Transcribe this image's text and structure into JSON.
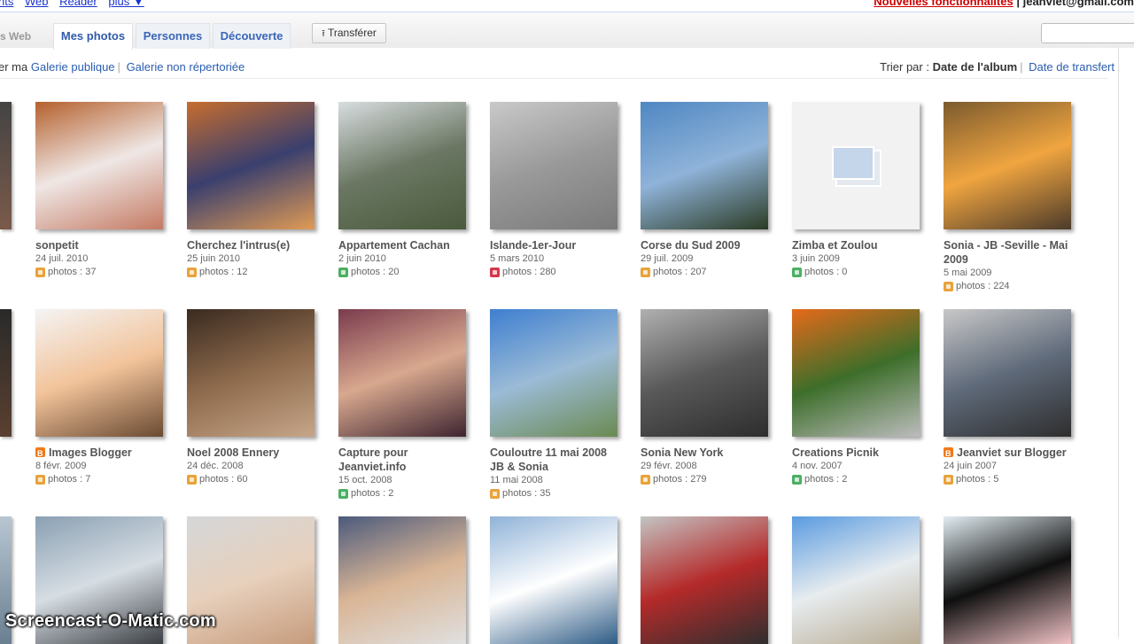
{
  "gbar": {
    "left_links": [
      "nts",
      "Web",
      "Reader",
      "plus ▼"
    ],
    "new_features": "Nouvelles fonctionnalités",
    "separator": "|",
    "account": "jeanviet@gmail.com"
  },
  "tabs": {
    "prefix": "s Web",
    "items": [
      {
        "label": "Mes photos",
        "active": true
      },
      {
        "label": "Personnes",
        "active": false
      },
      {
        "label": "Découverte",
        "active": false
      }
    ],
    "upload_label": "Transférer",
    "search_placeholder": ""
  },
  "subheader": {
    "prefix": "er ma",
    "public_gallery": "Galerie publique",
    "unlisted_gallery": "Galerie non répertoriée",
    "sep": "|",
    "sort_label": "Trier par :",
    "sort_active": "Date de l'album",
    "sort_other": "Date de transfert"
  },
  "albums": [
    {
      "title": "sonpetit",
      "date": "24 juil. 2010",
      "count": "photos : 37",
      "visibility": "unlisted",
      "blogger": false,
      "thumb": [
        "#b5602d",
        "#efe7e5",
        "#c47a63"
      ]
    },
    {
      "title": "Cherchez l'intrus(e)",
      "date": "25 juin 2010",
      "count": "photos : 12",
      "visibility": "unlisted",
      "blogger": false,
      "thumb": [
        "#c66d2e",
        "#3a3f6e",
        "#e09b55"
      ]
    },
    {
      "title": "Appartement Cachan",
      "date": "2 juin 2010",
      "count": "photos : 20",
      "visibility": "public",
      "blogger": false,
      "thumb": [
        "#d8dde0",
        "#6b7763",
        "#4a5a3c"
      ]
    },
    {
      "title": "Islande-1er-Jour",
      "date": "5 mars 2010",
      "count": "photos : 280",
      "visibility": "private",
      "blogger": false,
      "thumb": [
        "#c9c9c9",
        "#999",
        "#7a7a7a"
      ]
    },
    {
      "title": "Corse du Sud 2009",
      "date": "29 juil. 2009",
      "count": "photos : 207",
      "visibility": "unlisted",
      "blogger": false,
      "thumb": [
        "#4f87c2",
        "#8fb3d9",
        "#2b3b24"
      ]
    },
    {
      "title": "Zimba et Zoulou",
      "date": "3 juin 2009",
      "count": "photos : 0",
      "visibility": "public",
      "blogger": false,
      "thumb": [
        "#f1f1f1",
        "#f1f1f1",
        "#f1f1f1"
      ],
      "empty": true
    },
    {
      "title": "Sonia - JB -Seville - Mai 2009",
      "date": "5 mai 2009",
      "count": "photos : 224",
      "visibility": "unlisted",
      "blogger": false,
      "thumb": [
        "#7b5a2e",
        "#f0a540",
        "#4b3a2a"
      ]
    },
    {
      "title": "Images Blogger",
      "date": "8 févr. 2009",
      "count": "photos : 7",
      "visibility": "unlisted",
      "blogger": true,
      "thumb": [
        "#f4f4f4",
        "#f2c39a",
        "#6a4a32"
      ]
    },
    {
      "title": "Noel 2008 Ennery",
      "date": "24 déc. 2008",
      "count": "photos : 60",
      "visibility": "unlisted",
      "blogger": false,
      "thumb": [
        "#3a2a20",
        "#8d6a4c",
        "#c7a588"
      ]
    },
    {
      "title": "Capture pour Jeanviet.info",
      "date": "15 oct. 2008",
      "count": "photos : 2",
      "visibility": "public",
      "blogger": false,
      "thumb": [
        "#7a3b4e",
        "#d8a88e",
        "#3e2430"
      ]
    },
    {
      "title": "Couloutre 11 mai 2008 JB & Sonia",
      "date": "11 mai 2008",
      "count": "photos : 35",
      "visibility": "unlisted",
      "blogger": false,
      "thumb": [
        "#3e7fd0",
        "#9bbbd6",
        "#6b8a52"
      ]
    },
    {
      "title": "Sonia New York",
      "date": "29 févr. 2008",
      "count": "photos : 279",
      "visibility": "unlisted",
      "blogger": false,
      "thumb": [
        "#b0b0b0",
        "#595959",
        "#2d2d2d"
      ]
    },
    {
      "title": "Creations Picnik",
      "date": "4 nov. 2007",
      "count": "photos : 2",
      "visibility": "public",
      "blogger": false,
      "thumb": [
        "#e56a1a",
        "#3d6e2a",
        "#bcbcbc"
      ]
    },
    {
      "title": "Jeanviet sur Blogger",
      "date": "24 juin 2007",
      "count": "photos : 5",
      "visibility": "unlisted",
      "blogger": true,
      "thumb": [
        "#c8c8c8",
        "#5f6a7a",
        "#2e2e2e"
      ]
    },
    {
      "title": "",
      "date": "",
      "count": "",
      "visibility": "",
      "blogger": false,
      "thumb": [
        "#8aa0b3",
        "#d6dde3",
        "#3b3f44"
      ]
    },
    {
      "title": "",
      "date": "",
      "count": "",
      "visibility": "",
      "blogger": false,
      "thumb": [
        "#d5d7d9",
        "#e7d0bc",
        "#c69b7c"
      ]
    },
    {
      "title": "",
      "date": "",
      "count": "",
      "visibility": "",
      "blogger": false,
      "thumb": [
        "#4c5a7c",
        "#d9b595",
        "#e0e0e0"
      ]
    },
    {
      "title": "",
      "date": "",
      "count": "",
      "visibility": "",
      "blogger": false,
      "thumb": [
        "#90b3d8",
        "#ffffff",
        "#2f5c86"
      ]
    },
    {
      "title": "",
      "date": "",
      "count": "",
      "visibility": "",
      "blogger": false,
      "thumb": [
        "#c4c4c4",
        "#b52a2a",
        "#2f2f2f"
      ]
    },
    {
      "title": "",
      "date": "",
      "count": "",
      "visibility": "",
      "blogger": false,
      "thumb": [
        "#5a9be0",
        "#e7ecef",
        "#b8ab93"
      ]
    },
    {
      "title": "",
      "date": "",
      "count": "",
      "visibility": "",
      "blogger": false,
      "thumb": [
        "#e2edf2",
        "#0f0f0f",
        "#f0c2c5"
      ]
    }
  ],
  "watermark": "Screencast-O-Matic.com",
  "colors": {
    "link": "#2a5db0",
    "unlisted": "#e8a33a",
    "private": "#d4374a",
    "public": "#4caf63",
    "blogger": "#f07a1c"
  }
}
